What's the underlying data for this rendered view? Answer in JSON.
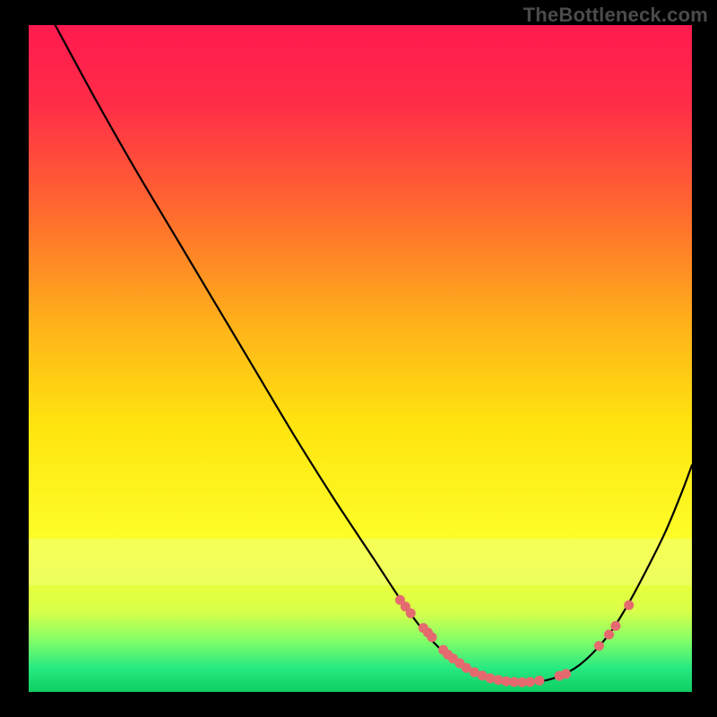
{
  "watermark": "TheBottleneck.com",
  "chart_data": {
    "type": "line",
    "title": "",
    "xlabel": "",
    "ylabel": "",
    "xlim": [
      0,
      100
    ],
    "ylim": [
      0,
      100
    ],
    "background_gradient": {
      "stops": [
        {
          "offset": 0.0,
          "color": "#ff1a4f"
        },
        {
          "offset": 0.12,
          "color": "#ff2d48"
        },
        {
          "offset": 0.28,
          "color": "#ff6a2e"
        },
        {
          "offset": 0.45,
          "color": "#ffb21a"
        },
        {
          "offset": 0.6,
          "color": "#ffe40f"
        },
        {
          "offset": 0.78,
          "color": "#fdff2a"
        },
        {
          "offset": 0.88,
          "color": "#d8ff4a"
        },
        {
          "offset": 0.92,
          "color": "#88ff66"
        },
        {
          "offset": 0.965,
          "color": "#26e981"
        },
        {
          "offset": 0.985,
          "color": "#18d96f"
        },
        {
          "offset": 1.0,
          "color": "#0ecf63"
        }
      ],
      "band_color": "#f0ff7a",
      "band_range_y": [
        77,
        84
      ]
    },
    "series": [
      {
        "name": "bottleneck-curve",
        "x": [
          4,
          10,
          16,
          22,
          28,
          34,
          40,
          46,
          52,
          57,
          61,
          64.5,
          68,
          71.5,
          75,
          79,
          83,
          87,
          90,
          93,
          96,
          98.5,
          100
        ],
        "y": [
          100,
          89,
          78.5,
          68.5,
          58.5,
          48.5,
          38.5,
          29,
          20,
          12.5,
          7.5,
          4.5,
          2.5,
          1.6,
          1.4,
          2.0,
          4.0,
          8.0,
          12.5,
          18.0,
          24.0,
          30.0,
          34.0
        ]
      }
    ],
    "marker_points": {
      "name": "highlighted-segments",
      "x": [
        56.0,
        56.8,
        57.6,
        59.5,
        60.2,
        60.8,
        62.5,
        63.2,
        64.0,
        65.0,
        66.0,
        67.2,
        68.4,
        69.6,
        70.8,
        72.0,
        73.2,
        74.4,
        75.6,
        77.0,
        80.0,
        81.0,
        86.0,
        87.5,
        88.5,
        90.5
      ],
      "y": [
        13.8,
        12.8,
        11.8,
        9.6,
        8.9,
        8.2,
        6.3,
        5.6,
        5.0,
        4.3,
        3.6,
        2.95,
        2.45,
        2.05,
        1.8,
        1.6,
        1.5,
        1.45,
        1.5,
        1.7,
        2.4,
        2.7,
        6.9,
        8.6,
        9.9,
        13.0
      ],
      "color": "#e46a6f",
      "radius": 5.5
    }
  }
}
